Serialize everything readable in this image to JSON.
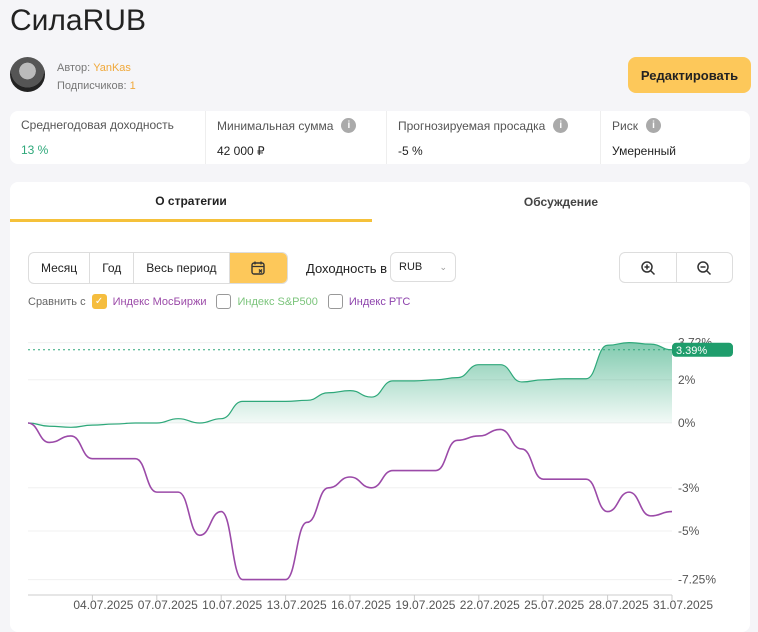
{
  "title": "СилаRUB",
  "author": {
    "label": "Автор:",
    "name": "YanKas",
    "subs_label": "Подписчиков:",
    "subs": "1"
  },
  "edit_label": "Редактировать",
  "stats": [
    {
      "label": "Среднегодовая доходность",
      "value": "13 %",
      "info": false
    },
    {
      "label": "Минимальная сумма",
      "value": "42 000 ₽",
      "info": true
    },
    {
      "label": "Прогнозируемая просадка",
      "value": "-5 %",
      "info": true
    },
    {
      "label": "Риск",
      "value": "Умеренный",
      "info": true
    }
  ],
  "tabs": [
    "О стратегии",
    "Обсуждение"
  ],
  "periods": [
    "Месяц",
    "Год",
    "Весь период"
  ],
  "calendar_icon": "calendar-x-icon",
  "yield_label": "Доходность в",
  "currency": "RUB",
  "compare": {
    "label": "Сравнить с",
    "items": [
      {
        "name": "Индекс МосБиржи",
        "checked": true,
        "color": "#9b4aa8"
      },
      {
        "name": "Индекс S&P500",
        "checked": false,
        "color": "#7bc47b"
      },
      {
        "name": "Индекс РТС",
        "checked": false,
        "color": "#8e44ad"
      }
    ]
  },
  "chart_data": {
    "type": "line",
    "x": [
      "01.07.2025",
      "02.07.2025",
      "03.07.2025",
      "04.07.2025",
      "05.07.2025",
      "06.07.2025",
      "07.07.2025",
      "08.07.2025",
      "09.07.2025",
      "10.07.2025",
      "11.07.2025",
      "12.07.2025",
      "13.07.2025",
      "14.07.2025",
      "15.07.2025",
      "16.07.2025",
      "17.07.2025",
      "18.07.2025",
      "19.07.2025",
      "20.07.2025",
      "21.07.2025",
      "22.07.2025",
      "23.07.2025",
      "24.07.2025",
      "25.07.2025",
      "26.07.2025",
      "27.07.2025",
      "28.07.2025",
      "29.07.2025",
      "30.07.2025",
      "31.07.2025"
    ],
    "xticks": [
      "04.07.2025",
      "07.07.2025",
      "10.07.2025",
      "13.07.2025",
      "16.07.2025",
      "19.07.2025",
      "22.07.2025",
      "25.07.2025",
      "28.07.2025",
      "31.07.2025"
    ],
    "yticks": [
      "3.72%",
      "2%",
      "0%",
      "-3%",
      "-5%",
      "-7.25%"
    ],
    "ytick_values": [
      3.72,
      2,
      0,
      -3,
      -5,
      -7.25
    ],
    "ylim": [
      -7.25,
      3.72
    ],
    "current_label": "3.39%",
    "series": [
      {
        "color": "#2ea87a",
        "values": [
          0,
          -0.15,
          -0.2,
          -0.1,
          -0.05,
          0,
          0,
          0.2,
          0,
          0.2,
          1.0,
          1.0,
          1.0,
          1.05,
          1.4,
          1.5,
          1.2,
          1.95,
          1.95,
          2.0,
          2.1,
          2.7,
          2.7,
          1.9,
          2.0,
          2.05,
          2.05,
          3.6,
          3.72,
          3.65,
          3.39
        ]
      },
      {
        "name": "Индекс МосБиржи",
        "color": "#9b4aa8",
        "values": [
          0,
          -0.9,
          -0.6,
          -1.65,
          -1.65,
          -1.65,
          -3.2,
          -3.2,
          -5.2,
          -4.1,
          -7.25,
          -7.25,
          -7.25,
          -4.6,
          -3.0,
          -2.5,
          -3.0,
          -2.2,
          -2.2,
          -2.2,
          -0.8,
          -0.6,
          -0.3,
          -1.2,
          -2.6,
          -2.6,
          -2.6,
          -4.1,
          -3.2,
          -4.3,
          -4.1
        ]
      }
    ]
  }
}
